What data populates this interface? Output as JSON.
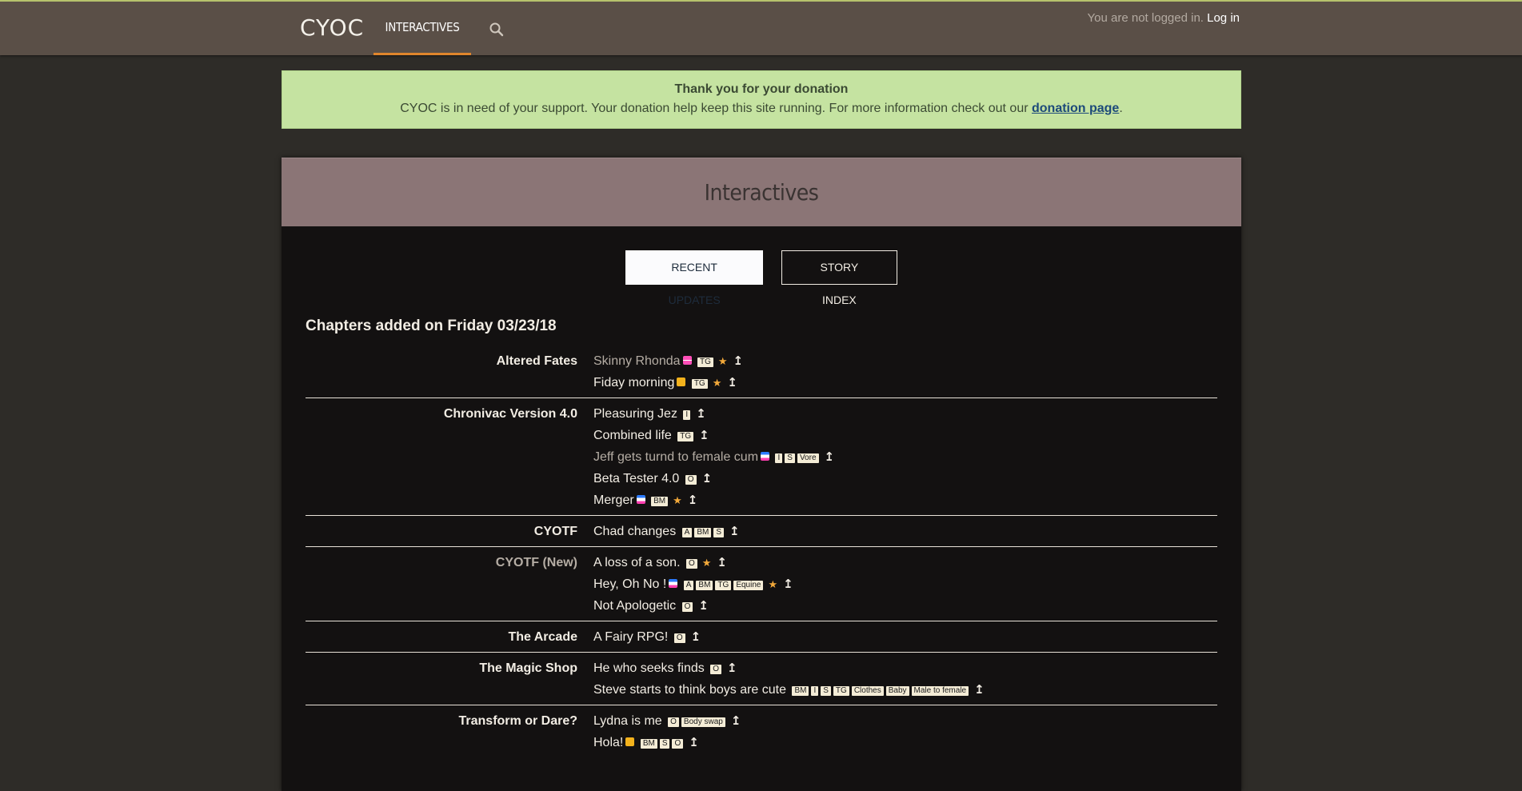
{
  "nav": {
    "brand": "CYOC",
    "tab": "Interactives",
    "login_prefix": "You are not logged in.",
    "login_link": "Log in"
  },
  "alert": {
    "title": "Thank you for your donation",
    "body": "CYOC is in need of your support. Your donation help keep this site running. For more information check out our",
    "link": "donation page",
    "suffix": "."
  },
  "panel": {
    "title": "Interactives",
    "btn_recent": "Recent Updates",
    "btn_index": "Story Index",
    "date_heading": "Chapters added on Friday 03/23/18"
  },
  "groups": [
    {
      "story": "Altered Fates",
      "chapters": [
        {
          "title": "Skinny Rhonda",
          "tags": [
            "TG"
          ]
        },
        {
          "title": "Fiday morning",
          "tags": [
            "TG"
          ]
        }
      ]
    },
    {
      "story": "Chronivac Version 4.0",
      "chapters": [
        {
          "title": "Pleasuring Jez",
          "tags": [
            "I"
          ]
        },
        {
          "title": "Combined life",
          "tags": [
            "TG"
          ]
        },
        {
          "title": "Jeff gets turnd to female cum",
          "tags": [
            "I",
            "S",
            "Vore"
          ]
        },
        {
          "title": "Beta Tester 4.0",
          "tags": [
            "O"
          ]
        },
        {
          "title": "Merger",
          "tags": [
            "BM"
          ]
        }
      ]
    },
    {
      "story": "CYOTF",
      "chapters": [
        {
          "title": "Chad changes",
          "tags": [
            "A",
            "BM",
            "S"
          ]
        }
      ]
    },
    {
      "story": "CYOTF (New)",
      "chapters": [
        {
          "title": "A loss of a son.",
          "tags": [
            "O"
          ]
        },
        {
          "title": "Hey, Oh No !",
          "tags": [
            "A",
            "BM",
            "TG",
            "Equine"
          ]
        },
        {
          "title": "Not Apologetic",
          "tags": [
            "O"
          ]
        }
      ]
    },
    {
      "story": "The Arcade",
      "chapters": [
        {
          "title": "A Fairy RPG!",
          "tags": [
            "O"
          ]
        }
      ]
    },
    {
      "story": "The Magic Shop",
      "chapters": [
        {
          "title": "He who seeks finds",
          "tags": [
            "O"
          ]
        },
        {
          "title": "Steve starts to think boys are cute",
          "tags": [
            "BM",
            "I",
            "S",
            "TG",
            "Clothes",
            "Baby",
            "Male to female"
          ]
        }
      ]
    },
    {
      "story": "Transform or Dare?",
      "chapters": [
        {
          "title": "Lydna is me",
          "tags": [
            "O",
            "Body swap"
          ]
        },
        {
          "title": "Hola!",
          "tags": [
            "BM",
            "S",
            "O"
          ]
        }
      ]
    }
  ],
  "glyphs": {
    "star": "★",
    "up": "↥"
  },
  "icons": {
    "search": "search-icon",
    "up": "up-arrow-icon",
    "star": "star-icon"
  }
}
